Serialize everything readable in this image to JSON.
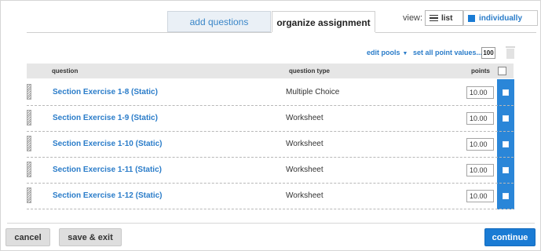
{
  "tabs": {
    "add_questions": "add questions",
    "organize_assignment": "organize assignment"
  },
  "view": {
    "label": "view:",
    "list": "list",
    "individually": "individually"
  },
  "toolbar": {
    "edit_pools": "edit pools",
    "set_all_points": "set all point values...",
    "point_value": "100"
  },
  "table": {
    "headers": {
      "question": "question",
      "question_type": "question type",
      "points": "points"
    },
    "rows": [
      {
        "question": "Section Exercise 1-8 (Static)",
        "type": "Multiple Choice",
        "points": "10.00"
      },
      {
        "question": "Section Exercise 1-9 (Static)",
        "type": "Worksheet",
        "points": "10.00"
      },
      {
        "question": "Section Exercise 1-10 (Static)",
        "type": "Worksheet",
        "points": "10.00"
      },
      {
        "question": "Section Exercise 1-11 (Static)",
        "type": "Worksheet",
        "points": "10.00"
      },
      {
        "question": "Section Exercise 1-12 (Static)",
        "type": "Worksheet",
        "points": "10.00"
      }
    ]
  },
  "footer": {
    "cancel": "cancel",
    "save_exit": "save & exit",
    "continue": "continue"
  },
  "colors": {
    "accent_blue": "#1a7bd4",
    "link_blue": "#2a7cc9",
    "header_gray": "#e6e6e6"
  }
}
